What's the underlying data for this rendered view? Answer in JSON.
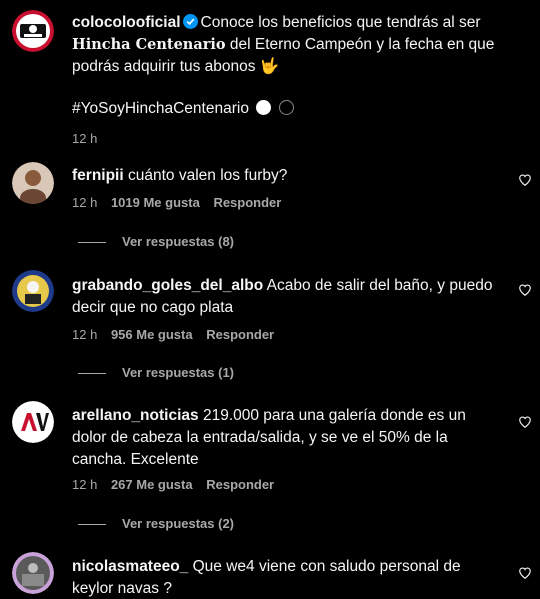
{
  "post": {
    "username": "colocolooficial",
    "caption_part1": "Conoce los beneficios que tendrás al ser ",
    "caption_bold": "Hincha Centenario",
    "caption_part2": " del Eterno Campeón y la fecha en que podrás adquirir tus abonos 🤟",
    "hashtag": "#YoSoyHinchaCentenario",
    "time": "12 h"
  },
  "comments": [
    {
      "username": "fernipii",
      "text": "cuánto valen los furby?",
      "time": "12 h",
      "likes": "1019 Me gusta",
      "reply": "Responder",
      "view_replies": "Ver respuestas (8)"
    },
    {
      "username": "grabando_goles_del_albo",
      "text": "Acabo de salir del baño, y puedo decir que no cago plata",
      "time": "12 h",
      "likes": "956 Me gusta",
      "reply": "Responder",
      "view_replies": "Ver respuestas (1)"
    },
    {
      "username": "arellano_noticias",
      "text": "219.000 para una galería donde es un dolor de cabeza la entrada/salida, y se ve el 50% de la cancha. Excelente",
      "time": "12 h",
      "likes": "267 Me gusta",
      "reply": "Responder",
      "view_replies": "Ver respuestas (2)"
    },
    {
      "username": "nicolasmateeo_",
      "text": "Que we4 viene con saludo personal de keylor navas ?"
    }
  ]
}
